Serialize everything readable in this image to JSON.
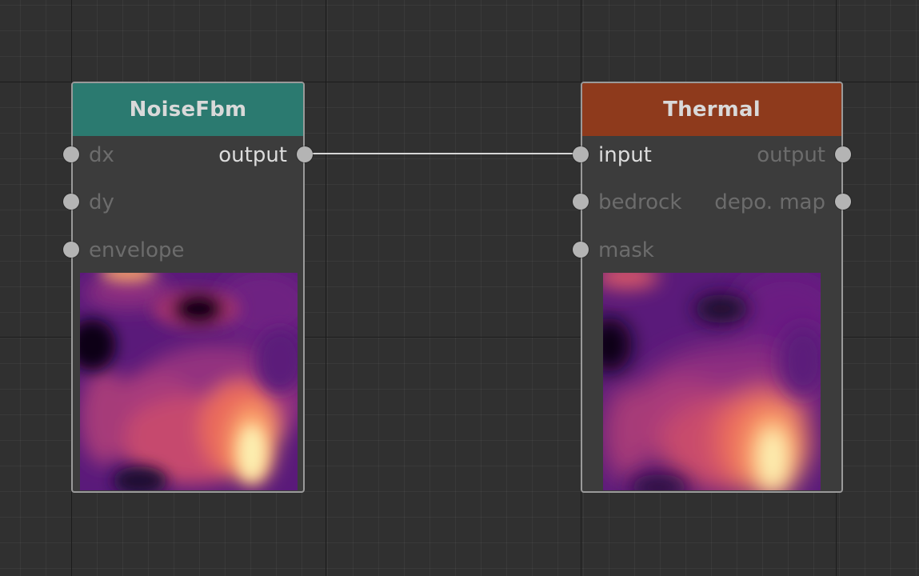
{
  "nodes": {
    "noisefbm": {
      "title": "NoiseFbm",
      "header_color": "#2b7a70",
      "inputs": [
        "dx",
        "dy",
        "envelope"
      ],
      "outputs": [
        "output"
      ],
      "connected_outputs": [
        "output"
      ]
    },
    "thermal": {
      "title": "Thermal",
      "header_color": "#8e3a1c",
      "inputs": [
        "input",
        "bedrock",
        "mask"
      ],
      "outputs": [
        "output",
        "depo. map"
      ],
      "connected_inputs": [
        "input"
      ]
    }
  },
  "links": [
    {
      "from": "noisefbm.output",
      "to": "thermal.input"
    }
  ],
  "preview_colormap": [
    "#0a0414",
    "#3a1465",
    "#7b2382",
    "#b63779",
    "#ee605e",
    "#fba06a",
    "#fcf2b0"
  ]
}
